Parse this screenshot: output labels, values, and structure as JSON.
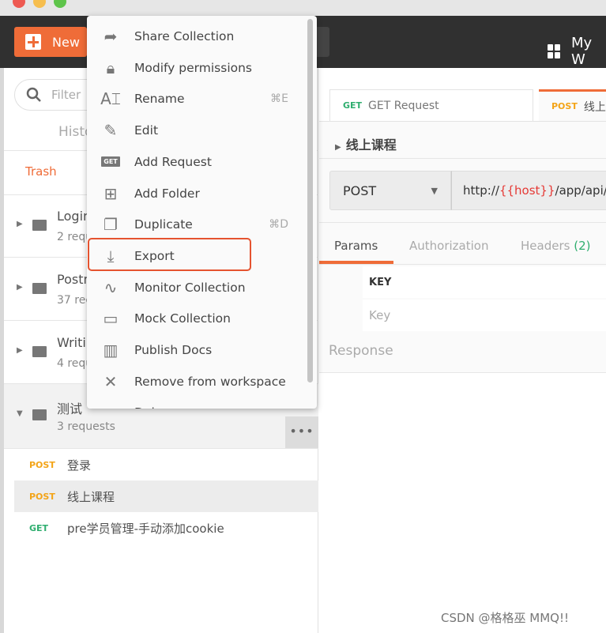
{
  "header": {
    "new_label": "New",
    "workspace": "My W"
  },
  "sidebar": {
    "filter_placeholder": "Filter",
    "history_tab": "Histo",
    "trash": "Trash",
    "collections": [
      {
        "name": "Login",
        "count": "2 requ"
      },
      {
        "name": "Postm",
        "count": "37 rec"
      },
      {
        "name": "Writi",
        "count": "4 requ"
      },
      {
        "name": "测试",
        "count": "3 requests"
      }
    ],
    "more_label": "•••",
    "requests": [
      {
        "method": "POST",
        "name": "登录"
      },
      {
        "method": "POST",
        "name": "线上课程",
        "selected": true
      },
      {
        "method": "GET",
        "name": "pre学员管理-手动添加cookie"
      }
    ]
  },
  "menu": {
    "items": [
      {
        "icon": "share-icon",
        "label": "Share Collection",
        "shortcut": ""
      },
      {
        "icon": "lock-icon",
        "label": "Modify permissions",
        "shortcut": ""
      },
      {
        "icon": "rename-icon",
        "label": "Rename",
        "shortcut": "⌘E"
      },
      {
        "icon": "pencil-icon",
        "label": "Edit",
        "shortcut": ""
      },
      {
        "icon": "get-badge-icon",
        "label": "Add Request",
        "shortcut": ""
      },
      {
        "icon": "add-folder-icon",
        "label": "Add Folder",
        "shortcut": ""
      },
      {
        "icon": "duplicate-icon",
        "label": "Duplicate",
        "shortcut": "⌘D"
      },
      {
        "icon": "download-icon",
        "label": "Export",
        "shortcut": "",
        "highlighted": true
      },
      {
        "icon": "pulse-icon",
        "label": "Monitor Collection",
        "shortcut": ""
      },
      {
        "icon": "server-icon",
        "label": "Mock Collection",
        "shortcut": ""
      },
      {
        "icon": "docs-icon",
        "label": "Publish Docs",
        "shortcut": ""
      },
      {
        "icon": "close-icon",
        "label": "Remove from workspace",
        "shortcut": ""
      },
      {
        "icon": "delete-icon",
        "label": "Dele",
        "shortcut": ""
      }
    ]
  },
  "main": {
    "tabs": [
      {
        "method": "GET",
        "label": "GET Request"
      },
      {
        "method": "POST",
        "label": "线上课程"
      }
    ],
    "request_title": "线上课程",
    "method": "POST",
    "url_prefix": "http://",
    "url_var": "{{host}}",
    "url_suffix": "/app/api/st",
    "subtabs": [
      "Params",
      "Authorization",
      "Headers"
    ],
    "headers_count": "(2)",
    "key_header": "KEY",
    "key_placeholder": "Key",
    "response": "Response"
  },
  "watermark": "CSDN @格格巫 MMQ!!",
  "colors": {
    "accent": "#ef6c38",
    "post": "#f3a417",
    "get": "#2fae6f",
    "highlight_box": "#e5532f",
    "url_var": "#e53935"
  }
}
